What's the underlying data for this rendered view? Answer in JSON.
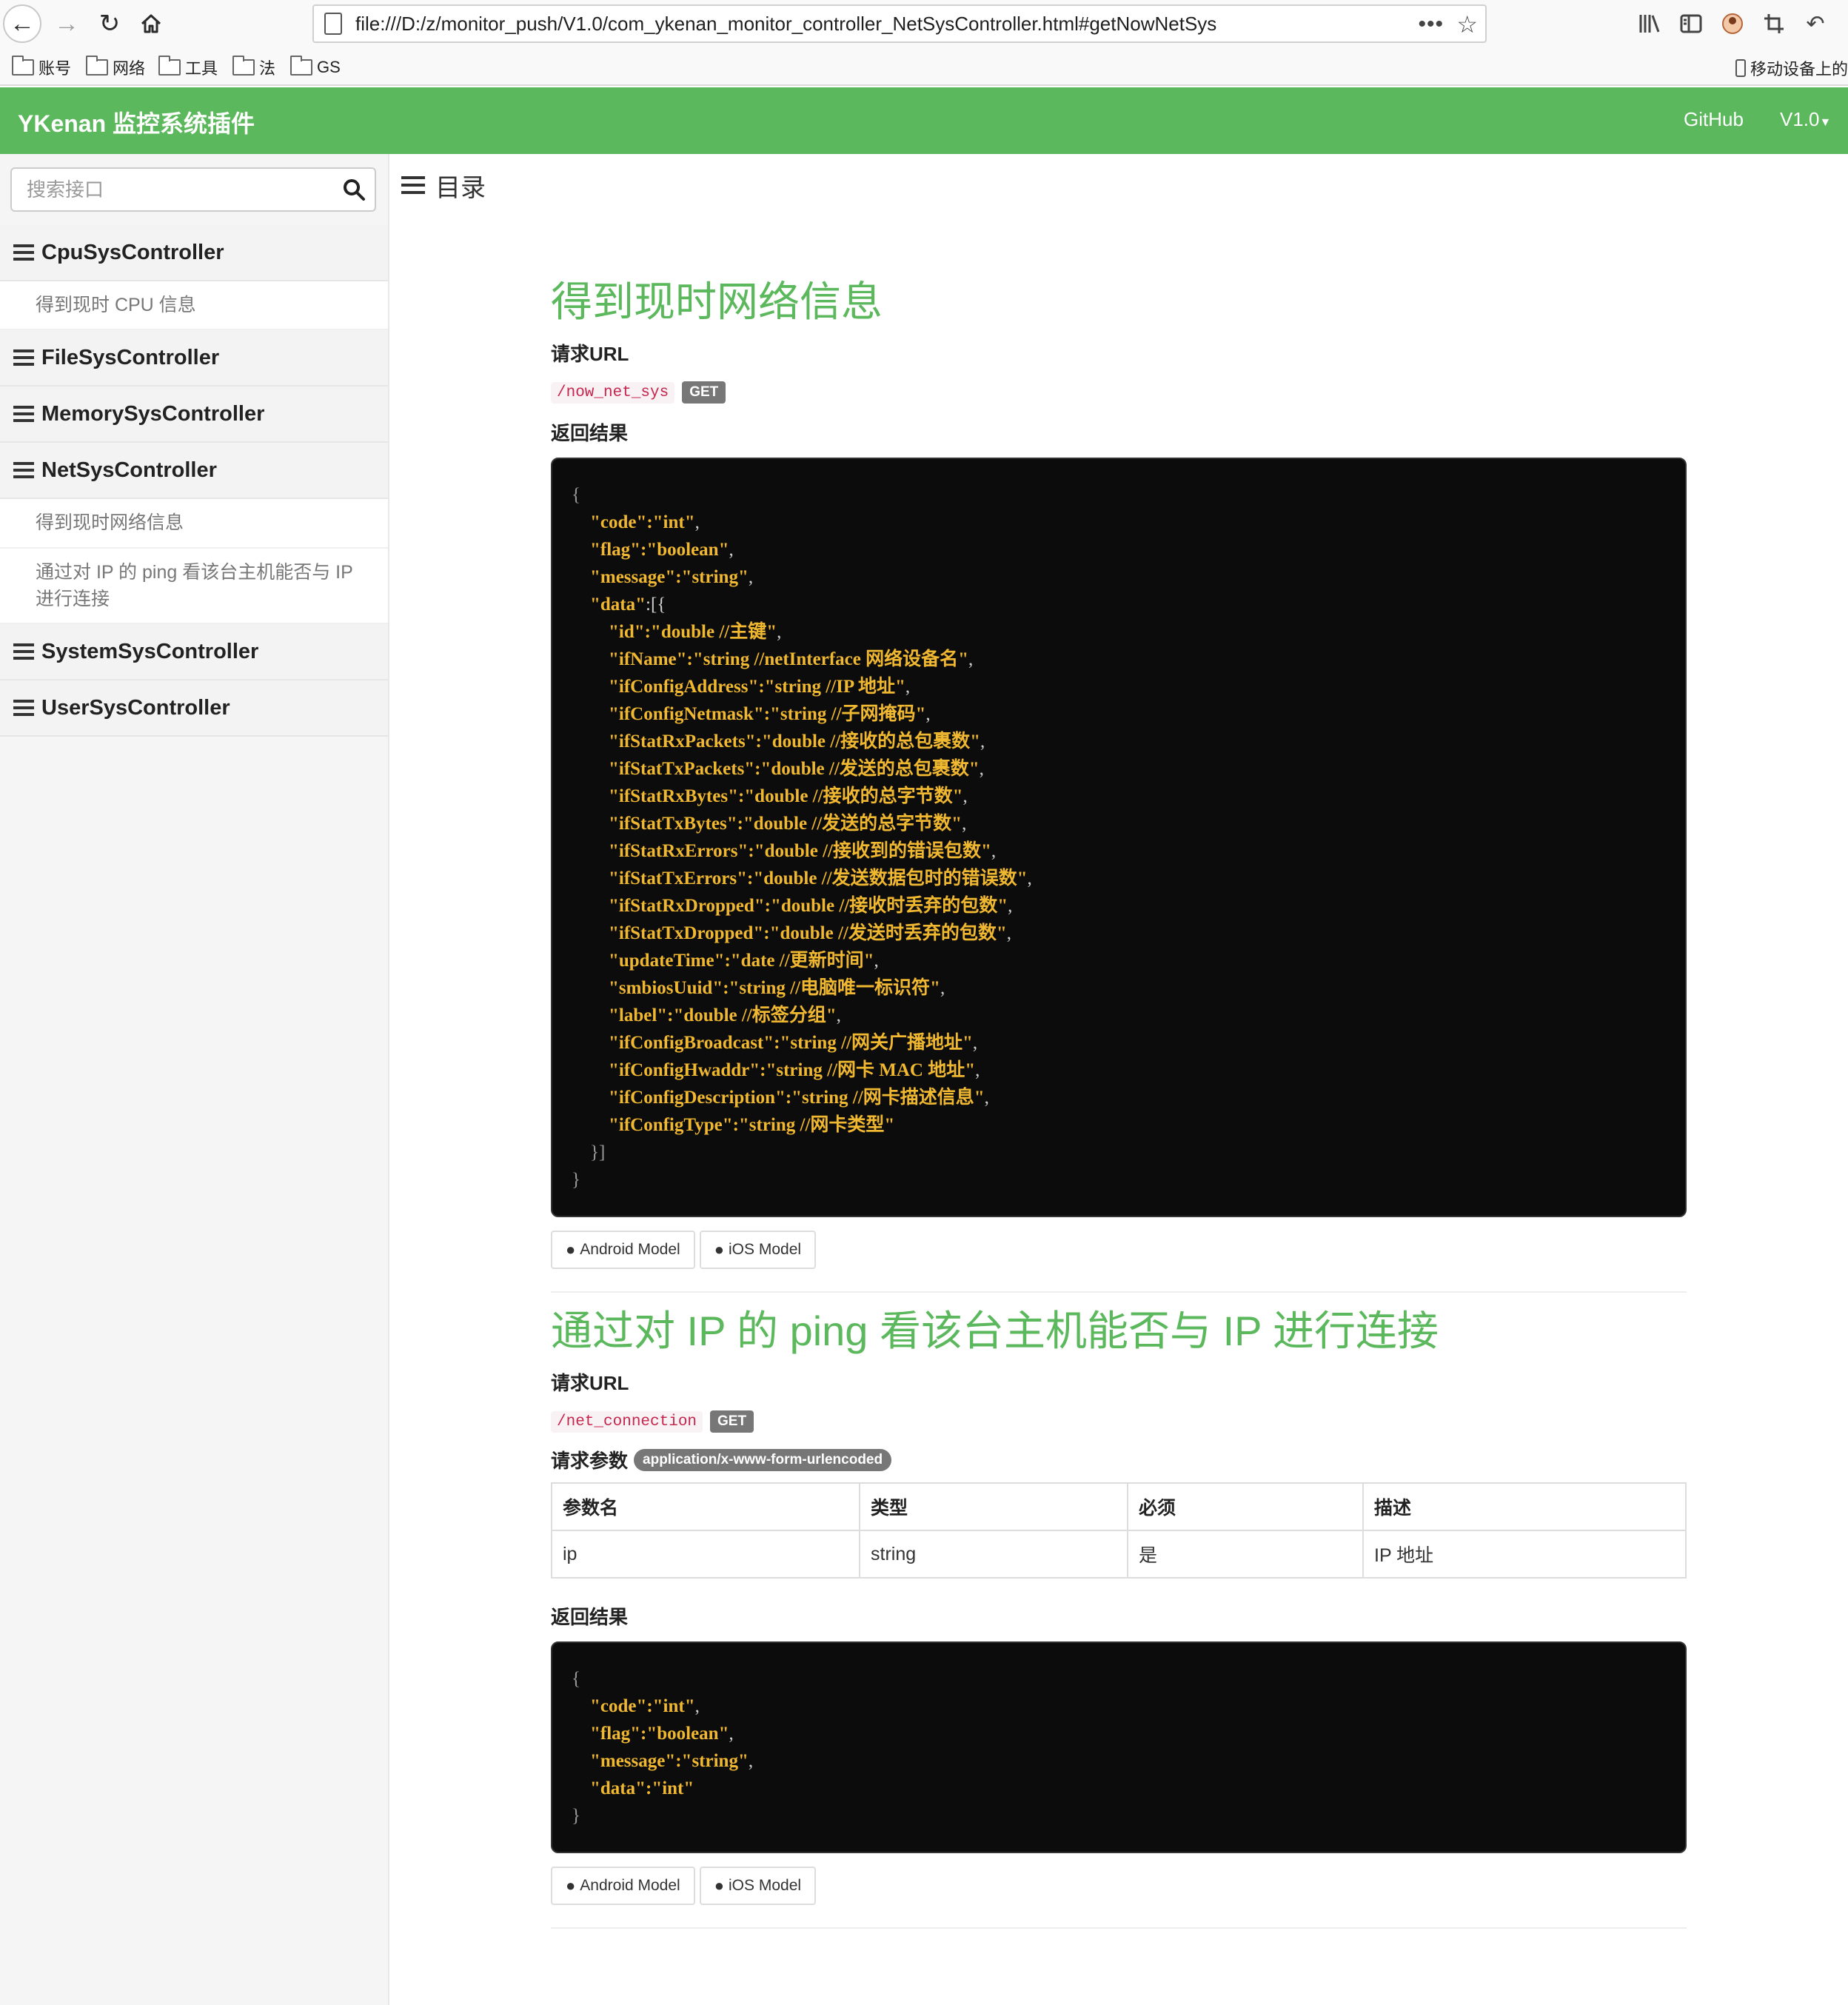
{
  "browser": {
    "url": "file:///D:/z/monitor_push/V1.0/com_ykenan_monitor_controller_NetSysController.html#getNowNetSys",
    "bookmarks": [
      "账号",
      "网络",
      "工具",
      "法",
      "GS"
    ],
    "mobile_bookmarks": "移动设备上的"
  },
  "navbar": {
    "brand": "YKenan 监控系统插件",
    "github": "GitHub",
    "version": "V1.0"
  },
  "sidebar": {
    "search_placeholder": "搜索接口",
    "groups": [
      {
        "name": "CpuSysController",
        "items": [
          "得到现时 CPU 信息"
        ]
      },
      {
        "name": "FileSysController",
        "items": []
      },
      {
        "name": "MemorySysController",
        "items": []
      },
      {
        "name": "NetSysController",
        "items": [
          "得到现时网络信息",
          "通过对 IP 的 ping 看该台主机能否与 IP 进行连接"
        ]
      },
      {
        "name": "SystemSysController",
        "items": []
      },
      {
        "name": "UserSysController",
        "items": []
      }
    ]
  },
  "main": {
    "toc_title": "目录",
    "sections": [
      {
        "title": "得到现时网络信息",
        "request_url_label": "请求URL",
        "url": "/now_net_sys",
        "method": "GET",
        "result_label": "返回结果",
        "code_lines": [
          [
            "{",
            ""
          ],
          [
            "    ",
            "\"code\":\"int\"",
            ","
          ],
          [
            "    ",
            "\"flag\":\"boolean\"",
            ","
          ],
          [
            "    ",
            "\"message\":\"string\"",
            ","
          ],
          [
            "    ",
            "\"data\"",
            ":[{"
          ],
          [
            "        ",
            "\"id\":\"double //主键\"",
            ","
          ],
          [
            "        ",
            "\"ifName\":\"string //netInterface 网络设备名\"",
            ","
          ],
          [
            "        ",
            "\"ifConfigAddress\":\"string //IP 地址\"",
            ","
          ],
          [
            "        ",
            "\"ifConfigNetmask\":\"string //子网掩码\"",
            ","
          ],
          [
            "        ",
            "\"ifStatRxPackets\":\"double //接收的总包裹数\"",
            ","
          ],
          [
            "        ",
            "\"ifStatTxPackets\":\"double //发送的总包裹数\"",
            ","
          ],
          [
            "        ",
            "\"ifStatRxBytes\":\"double //接收的总字节数\"",
            ","
          ],
          [
            "        ",
            "\"ifStatTxBytes\":\"double //发送的总字节数\"",
            ","
          ],
          [
            "        ",
            "\"ifStatRxErrors\":\"double //接收到的错误包数\"",
            ","
          ],
          [
            "        ",
            "\"ifStatTxErrors\":\"double //发送数据包时的错误数\"",
            ","
          ],
          [
            "        ",
            "\"ifStatRxDropped\":\"double //接收时丢弃的包数\"",
            ","
          ],
          [
            "        ",
            "\"ifStatTxDropped\":\"double //发送时丢弃的包数\"",
            ","
          ],
          [
            "        ",
            "\"updateTime\":\"date //更新时间\"",
            ","
          ],
          [
            "        ",
            "\"smbiosUuid\":\"string //电脑唯一标识符\"",
            ","
          ],
          [
            "        ",
            "\"label\":\"double //标签分组\"",
            ","
          ],
          [
            "        ",
            "\"ifConfigBroadcast\":\"string //网关广播地址\"",
            ","
          ],
          [
            "        ",
            "\"ifConfigHwaddr\":\"string //网卡 MAC 地址\"",
            ","
          ],
          [
            "        ",
            "\"ifConfigDescription\":\"string //网卡描述信息\"",
            ","
          ],
          [
            "        ",
            "\"ifConfigType\":\"string //网卡类型\"",
            ""
          ],
          [
            "    }]",
            ""
          ],
          [
            "}",
            ""
          ]
        ],
        "buttons": [
          "Android Model",
          "iOS Model"
        ]
      },
      {
        "title": "通过对 IP 的 ping 看该台主机能否与 IP 进行连接",
        "request_url_label": "请求URL",
        "url": "/net_connection",
        "method": "GET",
        "params_label": "请求参数",
        "content_type": "application/x-www-form-urlencoded",
        "params_columns": [
          "参数名",
          "类型",
          "必须",
          "描述"
        ],
        "params_rows": [
          [
            "ip",
            "string",
            "是",
            "IP 地址"
          ]
        ],
        "result_label": "返回结果",
        "code_lines": [
          [
            "{",
            ""
          ],
          [
            "    ",
            "\"code\":\"int\"",
            ","
          ],
          [
            "    ",
            "\"flag\":\"boolean\"",
            ","
          ],
          [
            "    ",
            "\"message\":\"string\"",
            ","
          ],
          [
            "    ",
            "\"data\":\"int\"",
            ""
          ],
          [
            "}",
            ""
          ]
        ],
        "buttons": [
          "Android Model",
          "iOS Model"
        ]
      }
    ]
  },
  "colors": {
    "brand_green": "#5cb85c",
    "code_bg": "#0c0c0c",
    "code_text": "#f0b730",
    "url_code": "#c7254e",
    "badge_gray": "#777777"
  },
  "icons": {
    "menu": "bars-icon",
    "search": "search-icon",
    "android": "android-icon",
    "apple": "apple-icon"
  }
}
